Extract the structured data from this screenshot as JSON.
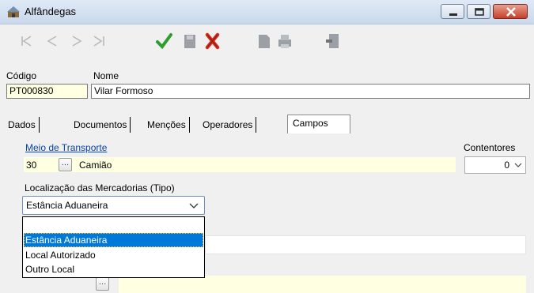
{
  "window": {
    "title": "Alfândegas"
  },
  "header": {
    "codigo_label": "Código",
    "nome_label": "Nome",
    "codigo_value": "PT000830",
    "nome_value": "Vilar Formoso"
  },
  "tabs": [
    {
      "label": "Dados Gerais"
    },
    {
      "label": "Documentos"
    },
    {
      "label": "Menções"
    },
    {
      "label": "Operadores"
    },
    {
      "label": "Campos Automáticos"
    }
  ],
  "campos": {
    "meio_label": "Meio de Transporte",
    "meio_code": "30",
    "meio_desc": "Camião",
    "contentores_label": "Contentores",
    "contentores_value": "0",
    "localizacao_label": "Localização das Mercadorias (Tipo)",
    "localizacao_selected": "Estância Aduaneira",
    "options": [
      "",
      "Estância Aduaneira",
      "Local Autorizado",
      "Outro Local"
    ],
    "ellipsis": "…"
  },
  "colors": {
    "field_bg": "#ffffe1",
    "selection": "#0078d7",
    "link": "#0645ad",
    "check": "#2e9d2e",
    "cross": "#d52a1a"
  }
}
